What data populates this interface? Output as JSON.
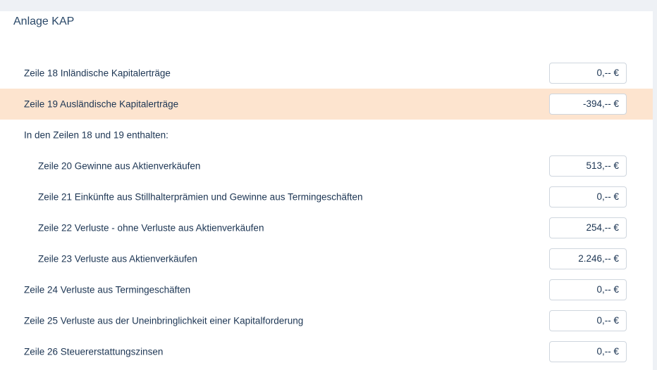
{
  "section": {
    "title": "Anlage KAP"
  },
  "rows": [
    {
      "label": "Zeile 18 Inländische Kapitalerträge",
      "value": "0,-- €"
    },
    {
      "label": "Zeile 19 Ausländische Kapitalerträge",
      "value": "-394,-- €",
      "highlighted": true
    },
    {
      "label": "In den Zeilen 18 und 19 enthalten:"
    },
    {
      "label": "Zeile 20 Gewinne aus Aktienverkäufen",
      "value": "513,-- €"
    },
    {
      "label": "Zeile 21 Einkünfte aus Stillhalterprämien und Gewinne aus Termingeschäften",
      "value": "0,-- €"
    },
    {
      "label": "Zeile 22 Verluste - ohne Verluste aus Aktienverkäufen",
      "value": "254,-- €"
    },
    {
      "label": "Zeile 23 Verluste aus Aktienverkäufen",
      "value": "2.246,-- €"
    },
    {
      "label": "Zeile 24 Verluste aus Termingeschäften",
      "value": "0,-- €"
    },
    {
      "label": "Zeile 25 Verluste aus der Uneinbringlichkeit einer Kapitalforderung",
      "value": "0,-- €"
    },
    {
      "label": "Zeile 26 Steuererstattungszinsen",
      "value": "0,-- €"
    }
  ],
  "colors": {
    "highlight": "#fde4cf",
    "text": "#1c3553",
    "border": "#cfd6de"
  }
}
